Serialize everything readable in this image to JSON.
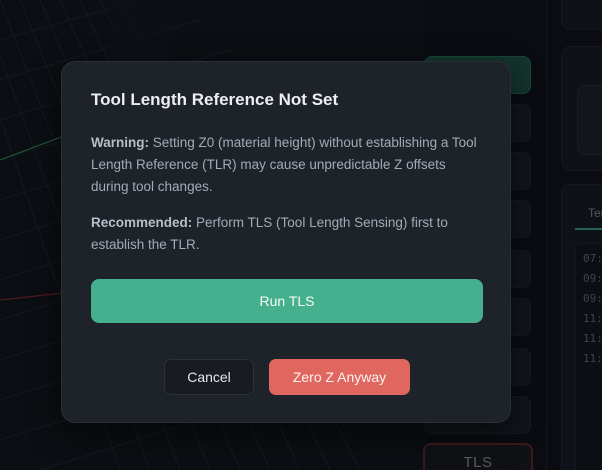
{
  "background": {
    "tls_button_label": "TLS",
    "tab_label": "Ter",
    "log_lines": [
      "07:",
      "09:",
      "09:",
      "11:",
      "11:",
      "11:"
    ]
  },
  "dialog": {
    "title": "Tool Length Reference Not Set",
    "warning": {
      "label": "Warning:",
      "text": " Setting Z0 (material height) without establishing a Tool Length Reference (TLR) may cause unpredictable Z offsets during tool changes."
    },
    "recommended": {
      "label": "Recommended:",
      "text": " Perform TLS (Tool Length Sensing) first to establish the TLR."
    },
    "primary_button": "Run TLS",
    "cancel_button": "Cancel",
    "danger_button": "Zero Z Anyway"
  },
  "colors": {
    "accent_green": "#46b08e",
    "danger_red": "#e0675f",
    "dialog_bg": "#1e2229"
  }
}
